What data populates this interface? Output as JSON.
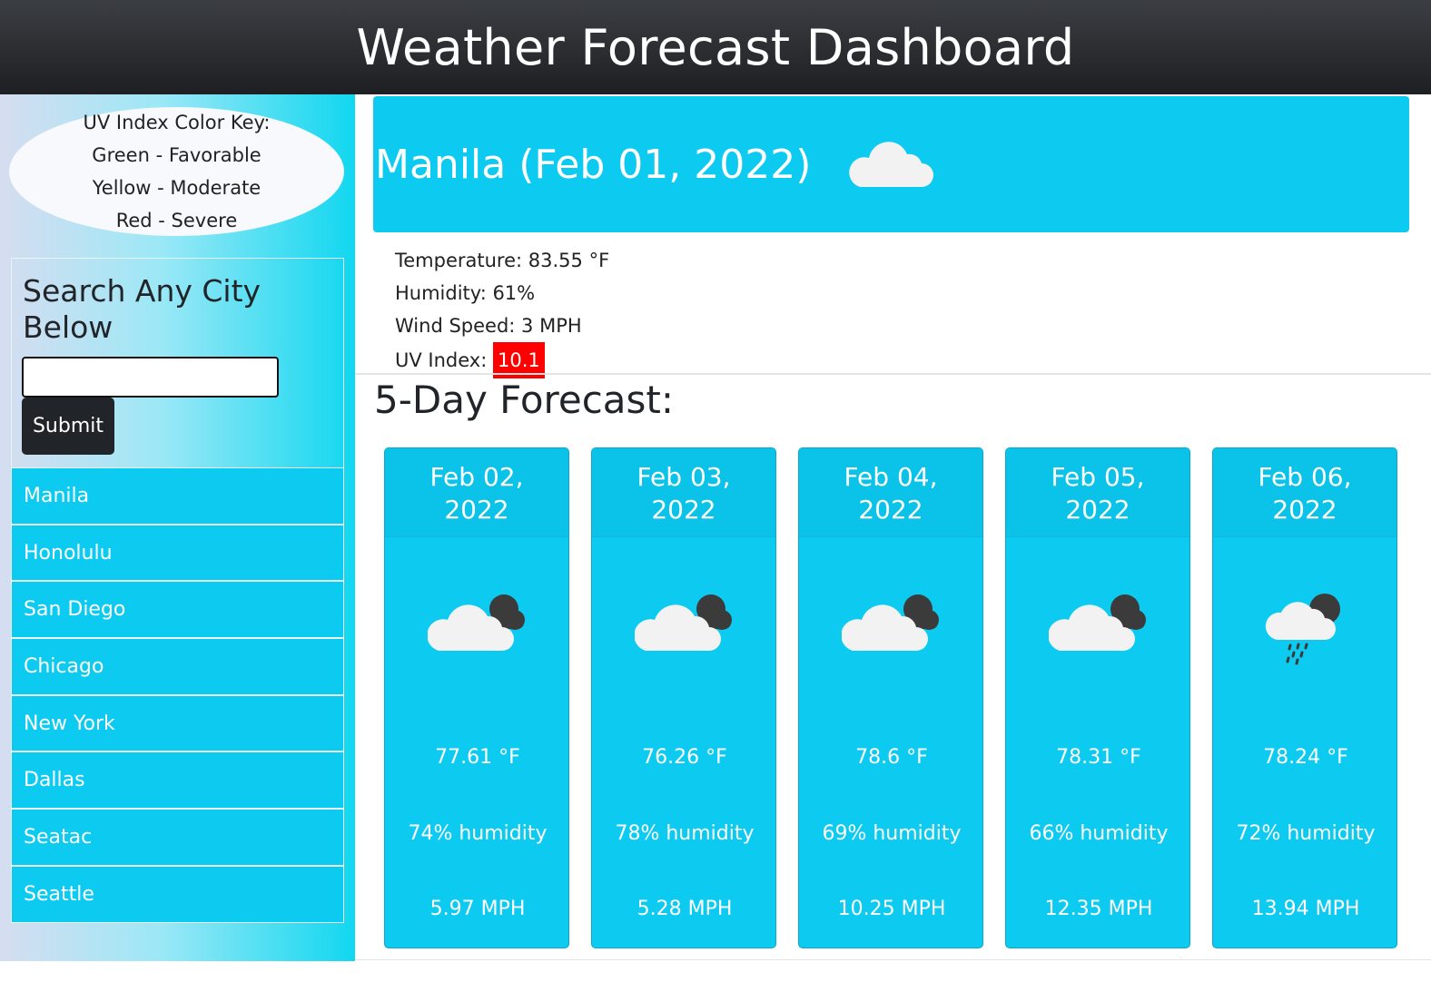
{
  "header": {
    "title": "Weather Forecast Dashboard"
  },
  "uv_key": {
    "title": "UV Index Color Key:",
    "green": "Green - Favorable",
    "yellow": "Yellow - Moderate",
    "red": "Red - Severe"
  },
  "search": {
    "title": "Search Any City Below",
    "input_value": "",
    "submit_label": "Submit"
  },
  "cities": [
    "Manila",
    "Honolulu",
    "San Diego",
    "Chicago",
    "New York",
    "Dallas",
    "Seatac",
    "Seattle"
  ],
  "current": {
    "heading": "Manila (Feb 01, 2022)",
    "icon": "cloud-icon",
    "temperature": "Temperature: 83.55 °F",
    "humidity": "Humidity: 61%",
    "wind": "Wind Speed: 3 MPH",
    "uv_label": "UV Index: ",
    "uv_value": "10.1",
    "uv_color": "#ff0000"
  },
  "forecast": {
    "title": "5-Day Forecast:",
    "days": [
      {
        "date_line1": "Feb 02,",
        "date_line2": "2022",
        "icon": "cloudy-icon",
        "temp": "77.61 °F",
        "humidity": "74% humidity",
        "wind": "5.97 MPH"
      },
      {
        "date_line1": "Feb 03,",
        "date_line2": "2022",
        "icon": "cloudy-icon",
        "temp": "76.26 °F",
        "humidity": "78% humidity",
        "wind": "5.28 MPH"
      },
      {
        "date_line1": "Feb 04,",
        "date_line2": "2022",
        "icon": "cloudy-icon",
        "temp": "78.6 °F",
        "humidity": "69% humidity",
        "wind": "10.25 MPH"
      },
      {
        "date_line1": "Feb 05,",
        "date_line2": "2022",
        "icon": "cloudy-icon",
        "temp": "78.31 °F",
        "humidity": "66% humidity",
        "wind": "12.35 MPH"
      },
      {
        "date_line1": "Feb 06,",
        "date_line2": "2022",
        "icon": "rain-icon",
        "temp": "78.24 °F",
        "humidity": "72% humidity",
        "wind": "13.94 MPH"
      }
    ]
  },
  "colors": {
    "accent": "#0dcaf0",
    "header_bg": "#212529",
    "button_bg": "#212529"
  }
}
